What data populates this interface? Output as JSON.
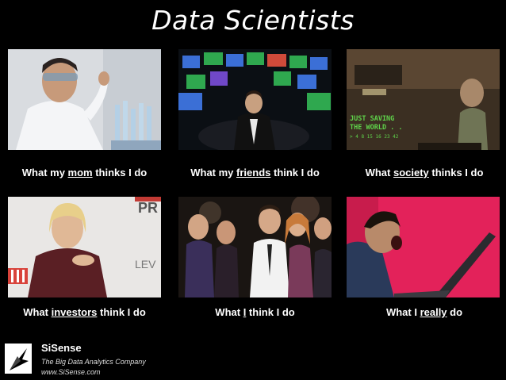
{
  "title": "Data Scientists",
  "panels": [
    {
      "caption_pre": "What my ",
      "caption_em": "mom",
      "caption_post": " thinks I do"
    },
    {
      "caption_pre": "What my ",
      "caption_em": "friends",
      "caption_post": " think I do"
    },
    {
      "caption_pre": "What ",
      "caption_em": "society",
      "caption_post": " thinks I do",
      "sign_line1": "JUST SAVING",
      "sign_line2": "THE WORLD . .",
      "sign_numbers": "> 4  8  15  16  23  42"
    },
    {
      "caption_pre": "What ",
      "caption_em": "investors",
      "caption_post": " think I do",
      "bg_text_top": "PR",
      "bg_text_mid": "LEV"
    },
    {
      "caption_pre": "What ",
      "caption_em": "I",
      "caption_post": " think I do"
    },
    {
      "caption_pre": "What I ",
      "caption_em": "really",
      "caption_post": " do"
    }
  ],
  "footer": {
    "brand": "SiSense",
    "tagline": "The Big Data Analytics Company",
    "url": "www.SiSense.com",
    "logo_icon": "sisense-arrow-icon"
  },
  "colors": {
    "background": "#000000",
    "text": "#ffffff",
    "sign_green": "#5fd24a",
    "rage_pink": "#e3225a"
  }
}
